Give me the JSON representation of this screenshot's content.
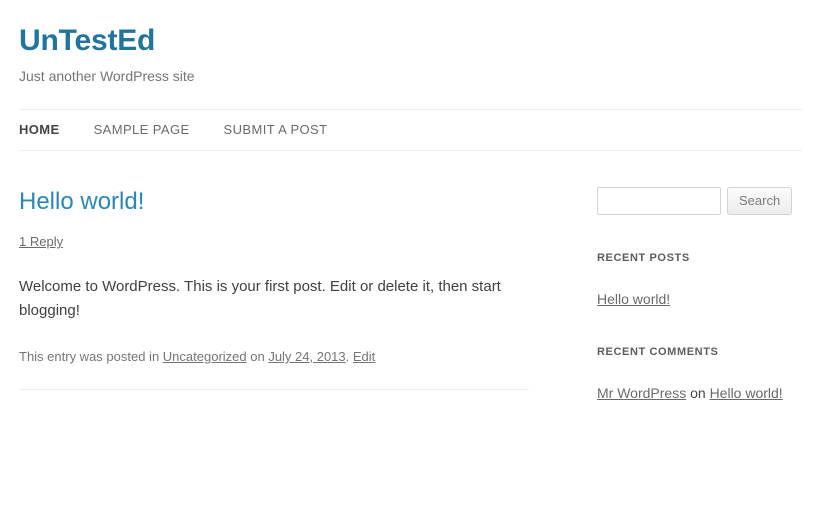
{
  "site": {
    "title": "UnTestEd",
    "description": "Just another WordPress site",
    "title_color": "#21759b",
    "link_color": "#2b87b5"
  },
  "nav": {
    "items": [
      {
        "label": "Home",
        "current": true
      },
      {
        "label": "Sample Page",
        "current": false
      },
      {
        "label": "Submit a Post",
        "current": false
      }
    ]
  },
  "post": {
    "title": "Hello world!",
    "comments_link": "1 Reply",
    "content": "Welcome to WordPress. This is your first post. Edit or delete it, then start blogging!",
    "meta": {
      "prefix": "This entry was posted in ",
      "category": "Uncategorized",
      "on": " on ",
      "date": "July 24, 2013",
      "separator": ". ",
      "edit": "Edit"
    }
  },
  "sidebar": {
    "search": {
      "value": "",
      "placeholder": "",
      "button_label": "Search"
    },
    "recent_posts": {
      "title": "Recent Posts",
      "items": [
        {
          "label": "Hello world!"
        }
      ]
    },
    "recent_comments": {
      "title": "Recent Comments",
      "items": [
        {
          "author": "Mr WordPress",
          "on": " on ",
          "post": "Hello world!"
        }
      ]
    }
  }
}
